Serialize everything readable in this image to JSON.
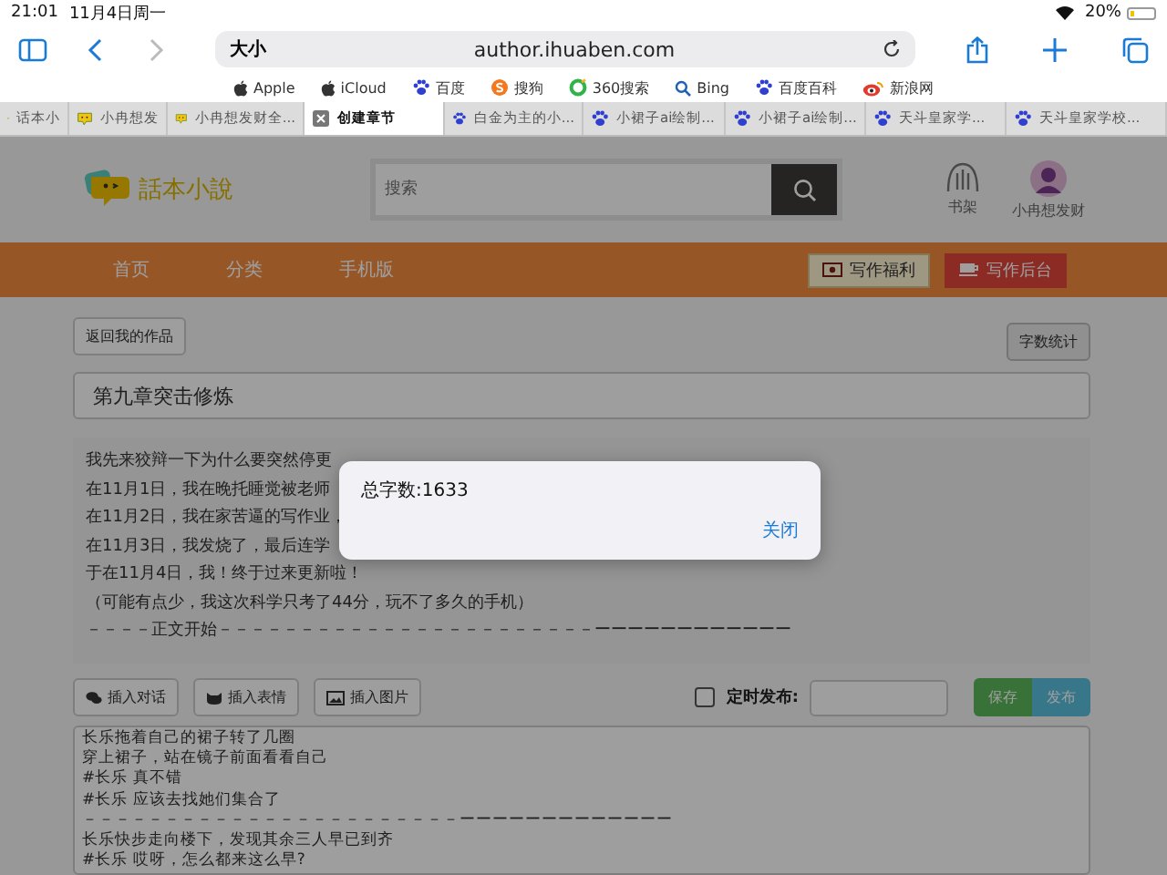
{
  "status_bar": {
    "time": "21:01",
    "date": "11月4日周一",
    "battery": "20%"
  },
  "browser": {
    "address_prefix": "大小",
    "url": "author.ihuaben.com"
  },
  "favorites": [
    {
      "label": "Apple",
      "kind": "apple"
    },
    {
      "label": "iCloud",
      "kind": "apple"
    },
    {
      "label": "百度",
      "kind": "paw"
    },
    {
      "label": "搜狗",
      "kind": "sogou"
    },
    {
      "label": "360搜索",
      "kind": "ring"
    },
    {
      "label": "Bing",
      "kind": "search"
    },
    {
      "label": "百度百科",
      "kind": "paw"
    },
    {
      "label": "新浪网",
      "kind": "eye"
    }
  ],
  "tabs": [
    {
      "label": "话本小",
      "kind": "huaben",
      "selected": false
    },
    {
      "label": "小冉想发",
      "kind": "huaben",
      "selected": false
    },
    {
      "label": "小冉想发财全...",
      "kind": "huaben",
      "selected": false
    },
    {
      "label": "创建章节",
      "selected": true
    },
    {
      "label": "白金为主的小...",
      "kind": "paw",
      "selected": false
    },
    {
      "label": "小裙子ai绘制...",
      "kind": "paw",
      "selected": false
    },
    {
      "label": "小裙子ai绘制...",
      "kind": "paw",
      "selected": false
    },
    {
      "label": "天斗皇家学...",
      "kind": "paw",
      "selected": false
    },
    {
      "label": "天斗皇家学校...",
      "kind": "paw",
      "selected": false
    }
  ],
  "site": {
    "logo_text": "話本小說",
    "search_placeholder": "搜索",
    "shelf_label": "书架",
    "user_name": "小冉想发财"
  },
  "nav": [
    "首页",
    "分类",
    "手机版"
  ],
  "nav_buttons": [
    {
      "label": "写作福利",
      "kind": "welfare"
    },
    {
      "label": "写作后台",
      "kind": "backend"
    }
  ],
  "back_button": "返回我的作品",
  "word_count_button": "字数统计",
  "chapter_title": "第九章突击修炼",
  "preface_lines": [
    "我先来狡辩一下为什么要突然停更",
    "在11月1日，我在晚托睡觉被老师",
    "在11月2日，我在家苦逼的写作业，",
    "在11月3日，我发烧了，最后连学",
    "于在11月4日，我！终于过来更新啦！",
    "（可能有点少，我这次科学只考了44分，玩不了多久的手机）",
    "－－－－正文开始－－－－－－－－－－－－－－－－－－－－－－－ーーーーーーーーーーーー"
  ],
  "insert_buttons": [
    {
      "label": "插入对话",
      "kind": "chat"
    },
    {
      "label": "插入表情",
      "kind": "emoji"
    },
    {
      "label": "插入图片",
      "kind": "image"
    }
  ],
  "schedule": {
    "label": "定时发布:",
    "checked": false
  },
  "save_button": "保存",
  "publish_button": "发布",
  "editor_lines": [
    "长乐拖着自己的裙子转了几圈",
    "穿上裙子，站在镜子前面看看自己",
    "#长乐 真不错",
    "#长乐 应该去找她们集合了",
    "－－－－－－－－－－－－－－－－－－－－－－－ーーーーーーーーーーーーー",
    "长乐快步走向楼下，发现其余三人早已到齐",
    "#长乐 哎呀，怎么都来这么早?"
  ],
  "dialog": {
    "message": "总字数:1633",
    "close_button": "关闭"
  }
}
